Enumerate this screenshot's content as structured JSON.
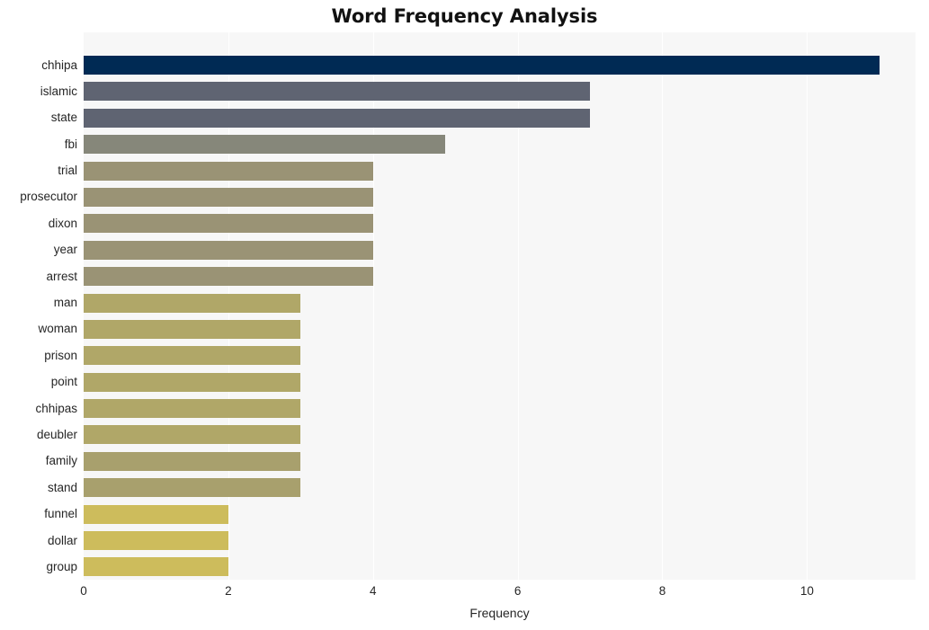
{
  "chart_data": {
    "type": "bar",
    "orientation": "horizontal",
    "title": "Word Frequency Analysis",
    "xlabel": "Frequency",
    "ylabel": "",
    "categories": [
      "chhipa",
      "islamic",
      "state",
      "fbi",
      "trial",
      "prosecutor",
      "dixon",
      "year",
      "arrest",
      "man",
      "woman",
      "prison",
      "point",
      "chhipas",
      "deubler",
      "family",
      "stand",
      "funnel",
      "dollar",
      "group"
    ],
    "values": [
      11,
      7,
      7,
      5,
      4,
      4,
      4,
      4,
      4,
      3,
      3,
      3,
      3,
      3,
      3,
      3,
      3,
      2,
      2,
      2
    ],
    "bar_colors": [
      "#002a54",
      "#5f6472",
      "#5f6472",
      "#86877a",
      "#9a9375",
      "#9a9375",
      "#9a9375",
      "#9a9375",
      "#9a9375",
      "#b0a768",
      "#b0a768",
      "#b0a768",
      "#b0a768",
      "#b0a768",
      "#b0a768",
      "#a8a06d",
      "#a8a06d",
      "#cdbc5c",
      "#cdbc5c",
      "#cdbc5c"
    ],
    "xlim": [
      0,
      11.5
    ],
    "xticks": [
      0,
      2,
      4,
      6,
      8,
      10
    ],
    "xtick_labels": [
      "0",
      "2",
      "4",
      "6",
      "8",
      "10"
    ],
    "grid": true,
    "grid_axis": "x",
    "legend": false,
    "plot_background": "#f7f7f7",
    "gridline_color": "#ffffff",
    "figure_background": "#ffffff"
  }
}
